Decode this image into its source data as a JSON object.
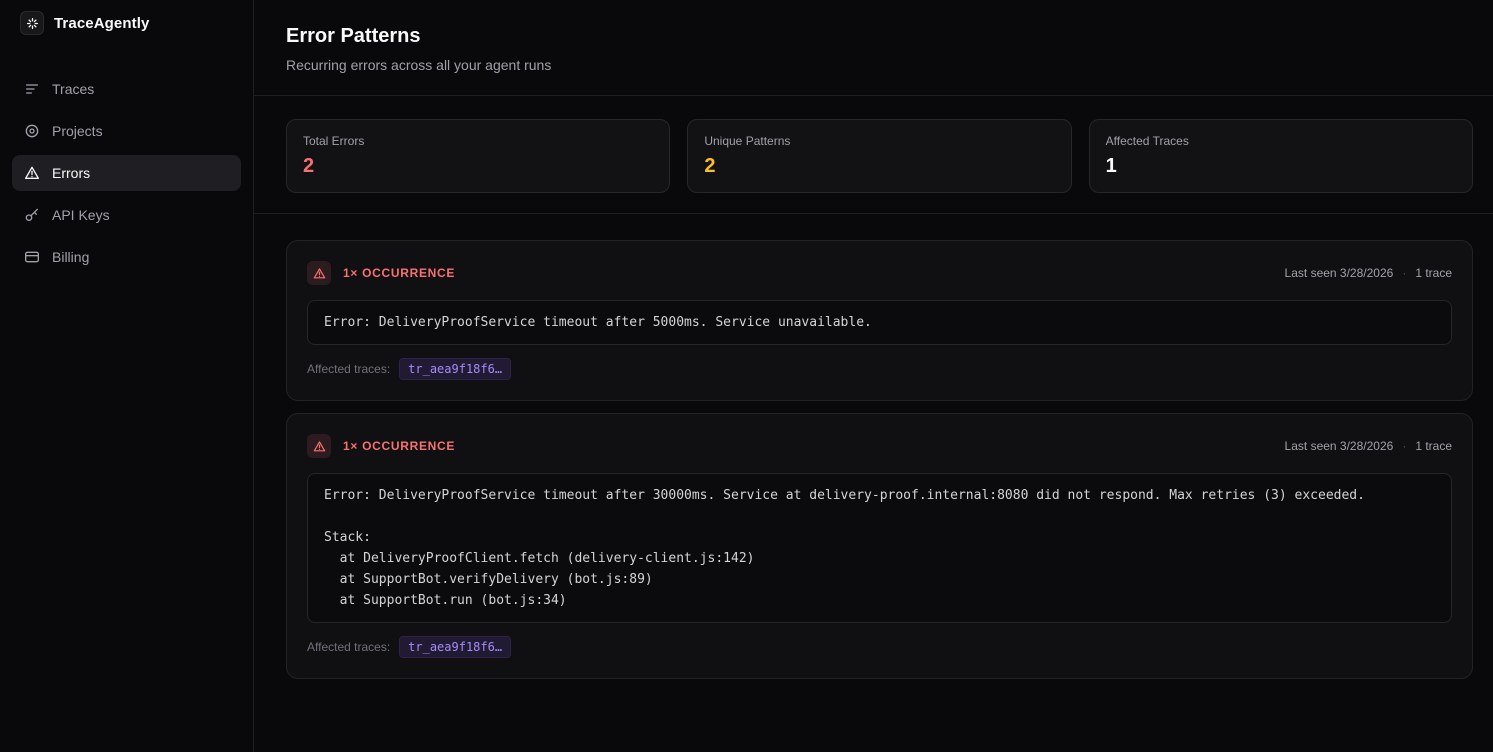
{
  "sidebar": {
    "brand": "TraceAgently",
    "items": [
      {
        "label": "Traces",
        "icon": "traces-icon",
        "active": false
      },
      {
        "label": "Projects",
        "icon": "projects-icon",
        "active": false
      },
      {
        "label": "Errors",
        "icon": "errors-icon",
        "active": true
      },
      {
        "label": "API Keys",
        "icon": "api-keys-icon",
        "active": false
      },
      {
        "label": "Billing",
        "icon": "billing-icon",
        "active": false
      }
    ]
  },
  "header": {
    "title": "Error Patterns",
    "subtitle": "Recurring errors across all your agent runs"
  },
  "stats": [
    {
      "label": "Total Errors",
      "value": "2",
      "color": "#f87171"
    },
    {
      "label": "Unique Patterns",
      "value": "2",
      "color": "#fbbf24"
    },
    {
      "label": "Affected Traces",
      "value": "1",
      "color": "#fafafa"
    }
  ],
  "ui": {
    "meta_separator": "·"
  },
  "error_patterns": [
    {
      "occurrence": "1× OCCURRENCE",
      "last_seen": "Last seen 3/28/2026",
      "trace_count": "1 trace",
      "message": "Error: DeliveryProofService timeout after 5000ms. Service unavailable.",
      "affected_label": "Affected traces:",
      "trace_id": "tr_aea9f18f6…"
    },
    {
      "occurrence": "1× OCCURRENCE",
      "last_seen": "Last seen 3/28/2026",
      "trace_count": "1 trace",
      "message": "Error: DeliveryProofService timeout after 30000ms. Service at delivery-proof.internal:8080 did not respond. Max retries (3) exceeded.\n\nStack:\n  at DeliveryProofClient.fetch (delivery-client.js:142)\n  at SupportBot.verifyDelivery (bot.js:89)\n  at SupportBot.run (bot.js:34)",
      "affected_label": "Affected traces:",
      "trace_id": "tr_aea9f18f6…"
    }
  ]
}
